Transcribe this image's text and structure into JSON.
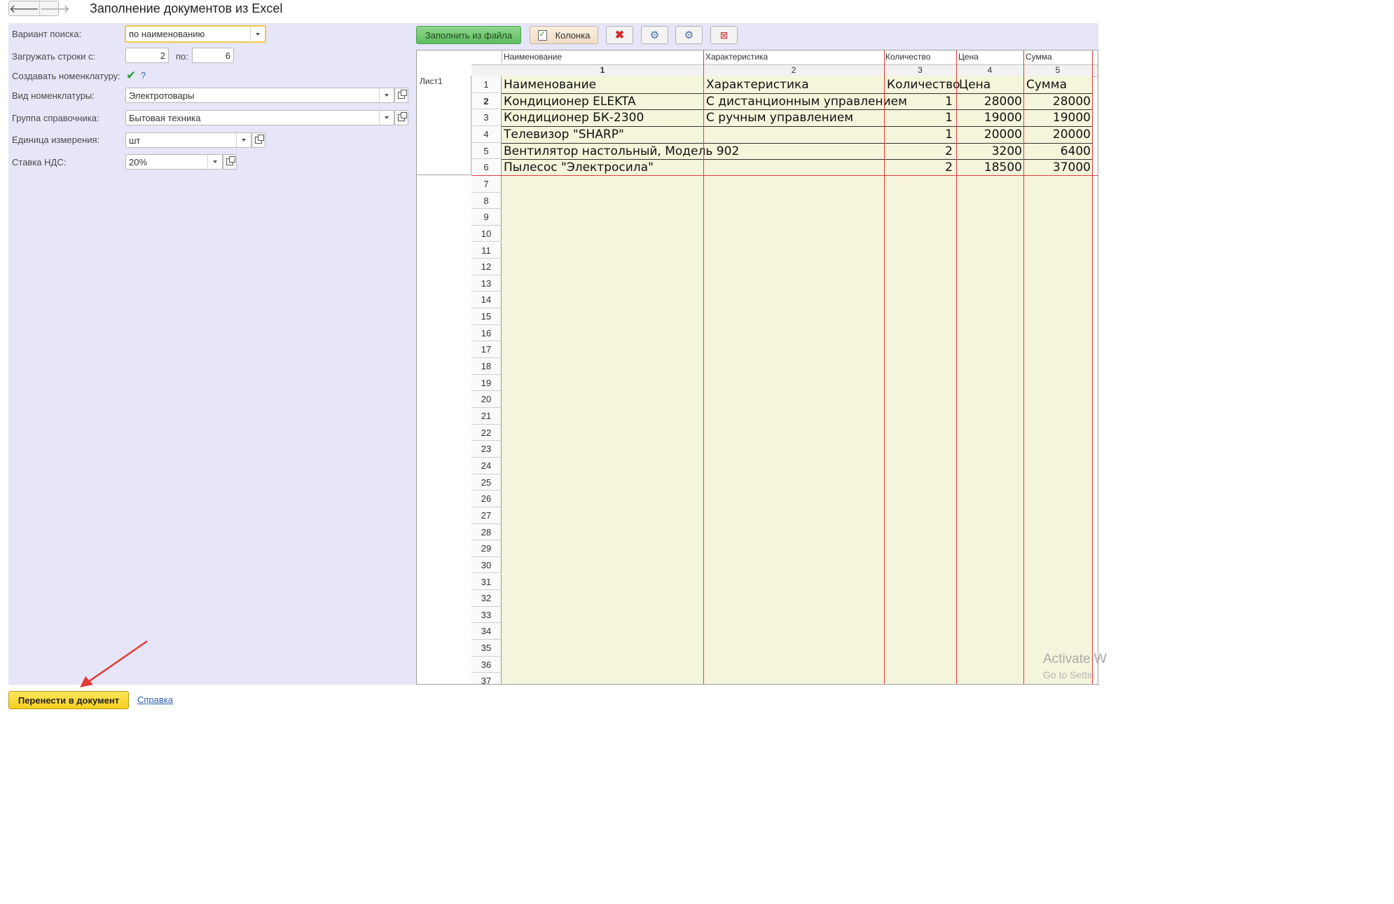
{
  "window": {
    "title": "Заполнение документов из Excel"
  },
  "nav": {
    "back_icon": "arrow-left-icon",
    "forward_icon": "arrow-right-icon"
  },
  "form": {
    "search_variant": {
      "label": "Вариант поиска:",
      "value": "по наименованию"
    },
    "load_rows": {
      "label": "Загружать строки с:",
      "from": "2",
      "to_label": "по:",
      "to": "6"
    },
    "create_nomenclature": {
      "label": "Создавать номенклатуру:",
      "checked": true,
      "help": "?"
    },
    "nomenclature_type": {
      "label": "Вид номенклатуры:",
      "value": "Электротовары"
    },
    "catalog_group": {
      "label": "Группа справочника:",
      "value": "Бытовая техника"
    },
    "unit": {
      "label": "Единица измерения:",
      "value": "шт"
    },
    "vat_rate": {
      "label": "Ставка НДС:",
      "value": "20%"
    }
  },
  "toolbar": {
    "fill_from_file": "Заполнить из файла",
    "column": "Колонка"
  },
  "sheet": {
    "sheet_name": "Лист1",
    "column_headers": [
      "Наименование",
      "Характеристика",
      "Количество",
      "Цена",
      "Сумма"
    ],
    "column_numbers": [
      "1",
      "2",
      "3",
      "4",
      "5"
    ],
    "row_numbers": [
      "1",
      "2",
      "3",
      "4",
      "5",
      "6",
      "7",
      "8",
      "9",
      "10",
      "11",
      "12",
      "13",
      "14",
      "15",
      "16",
      "17",
      "18",
      "19",
      "20",
      "21",
      "22",
      "23",
      "24",
      "25",
      "26",
      "27",
      "28",
      "29",
      "30",
      "31",
      "32",
      "33",
      "34",
      "35",
      "36",
      "37"
    ],
    "rows": [
      [
        "Наименование",
        "Характеристика",
        "Количество",
        "Цена",
        "Сумма"
      ],
      [
        "Кондиционер ELEKTA",
        "С дистанционным управлением",
        "1",
        "28000",
        "28000"
      ],
      [
        "Кондиционер БК-2300",
        "С ручным управлением",
        "1",
        "19000",
        "19000"
      ],
      [
        "Телевизор \"SHARP\"",
        "",
        "1",
        "20000",
        "20000"
      ],
      [
        "Вентилятор настольный, Модель 902",
        "",
        "2",
        "3200",
        "6400"
      ],
      [
        "Пылесос \"Электросила\"",
        "",
        "2",
        "18500",
        "37000"
      ]
    ]
  },
  "watermark": {
    "line1": "Activate W",
    "line2": "Go to Settin"
  },
  "footer": {
    "transfer_button": "Перенести в документ",
    "help_link": "Справка"
  }
}
